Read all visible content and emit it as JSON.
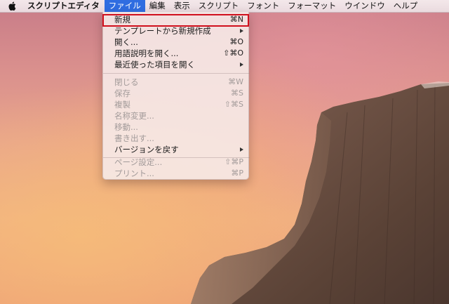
{
  "menubar": {
    "app_name": "スクリプトエディタ",
    "menus": [
      "ファイル",
      "編集",
      "表示",
      "スクリプト",
      "フォント",
      "フォーマット",
      "ウインドウ",
      "ヘルプ"
    ],
    "active_menu": "ファイル",
    "active_color": "#2f6de1"
  },
  "file_menu": {
    "items": [
      {
        "label": "新規",
        "shortcut": "⌘N",
        "enabled": true
      },
      {
        "label": "テンプレートから新規作成",
        "shortcut": "",
        "submenu": true,
        "enabled": true
      },
      {
        "label": "開く...",
        "shortcut": "⌘O",
        "enabled": true
      },
      {
        "label": "用語説明を開く...",
        "shortcut": "⇧⌘O",
        "enabled": true
      },
      {
        "label": "最近使った項目を開く",
        "shortcut": "",
        "submenu": true,
        "enabled": true
      },
      {
        "label": "閉じる",
        "shortcut": "⌘W",
        "enabled": false
      },
      {
        "label": "保存",
        "shortcut": "⌘S",
        "enabled": false
      },
      {
        "label": "複製",
        "shortcut": "⇧⌘S",
        "enabled": false
      },
      {
        "label": "名称変更...",
        "shortcut": "",
        "enabled": false
      },
      {
        "label": "移動...",
        "shortcut": "",
        "enabled": false
      },
      {
        "label": "書き出す...",
        "shortcut": "",
        "enabled": false
      },
      {
        "label": "バージョンを戻す",
        "shortcut": "",
        "submenu": true,
        "enabled": true
      },
      {
        "label": "ページ設定...",
        "shortcut": "⇧⌘P",
        "enabled": false
      },
      {
        "label": "プリント...",
        "shortcut": "⌘P",
        "enabled": false
      }
    ],
    "highlighted_item": "新規",
    "highlight_color": "#d0101d"
  }
}
